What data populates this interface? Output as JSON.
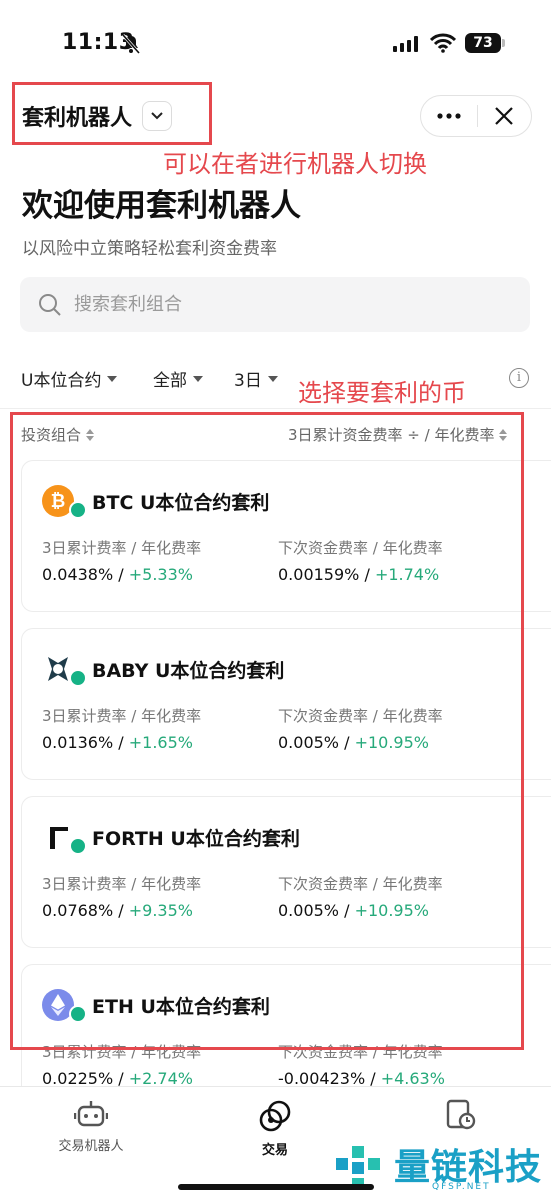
{
  "status_bar": {
    "time": "11:13",
    "battery": "73"
  },
  "header": {
    "robot_switch_label": "套利机器人"
  },
  "annotations": {
    "switch_note": "可以在者进行机器人切换",
    "coin_note": "选择要套利的币"
  },
  "title": "欢迎使用套利机器人",
  "subtitle": "以风险中立策略轻松套利资金费率",
  "search": {
    "placeholder": "搜索套利组合"
  },
  "filters": {
    "contract": "U本位合约",
    "scope": "全部",
    "period": "3日"
  },
  "list_header": {
    "left": "投资组合",
    "right": "3日累计资金费率 ÷ / 年化费率"
  },
  "cards": [
    {
      "title": "BTC U本位合约套利",
      "label_left": "3日累计费率 / 年化费率",
      "cum_rate": "0.0438%",
      "annual_rate": "+5.33%",
      "label_right": "下次资金费率 / 年化费率",
      "next_rate": "0.00159%",
      "next_annual": "+1.74%"
    },
    {
      "title": "BABY U本位合约套利",
      "label_left": "3日累计费率 / 年化费率",
      "cum_rate": "0.0136%",
      "annual_rate": "+1.65%",
      "label_right": "下次资金费率 / 年化费率",
      "next_rate": "0.005%",
      "next_annual": "+10.95%"
    },
    {
      "title": "FORTH U本位合约套利",
      "label_left": "3日累计费率 / 年化费率",
      "cum_rate": "0.0768%",
      "annual_rate": "+9.35%",
      "label_right": "下次资金费率 / 年化费率",
      "next_rate": "0.005%",
      "next_annual": "+10.95%"
    },
    {
      "title": "ETH U本位合约套利",
      "label_left": "3日累计费率 / 年化费率",
      "cum_rate": "0.0225%",
      "annual_rate": "+2.74%",
      "label_right": "下次资金费率 / 年化费率",
      "next_rate": "-0.00423%",
      "next_annual": "+4.63%"
    }
  ],
  "tabs": [
    {
      "label": "交易机器人",
      "icon": "robot-icon"
    },
    {
      "label": "交易",
      "icon": "trade-icon"
    },
    {
      "label": "",
      "icon": "history-icon"
    }
  ],
  "watermark": {
    "text": "量链科技",
    "sub": "QFSP.NET"
  },
  "colors": {
    "positive": "#26a97a",
    "annotation": "#e5484d",
    "badge": "#16b286"
  }
}
